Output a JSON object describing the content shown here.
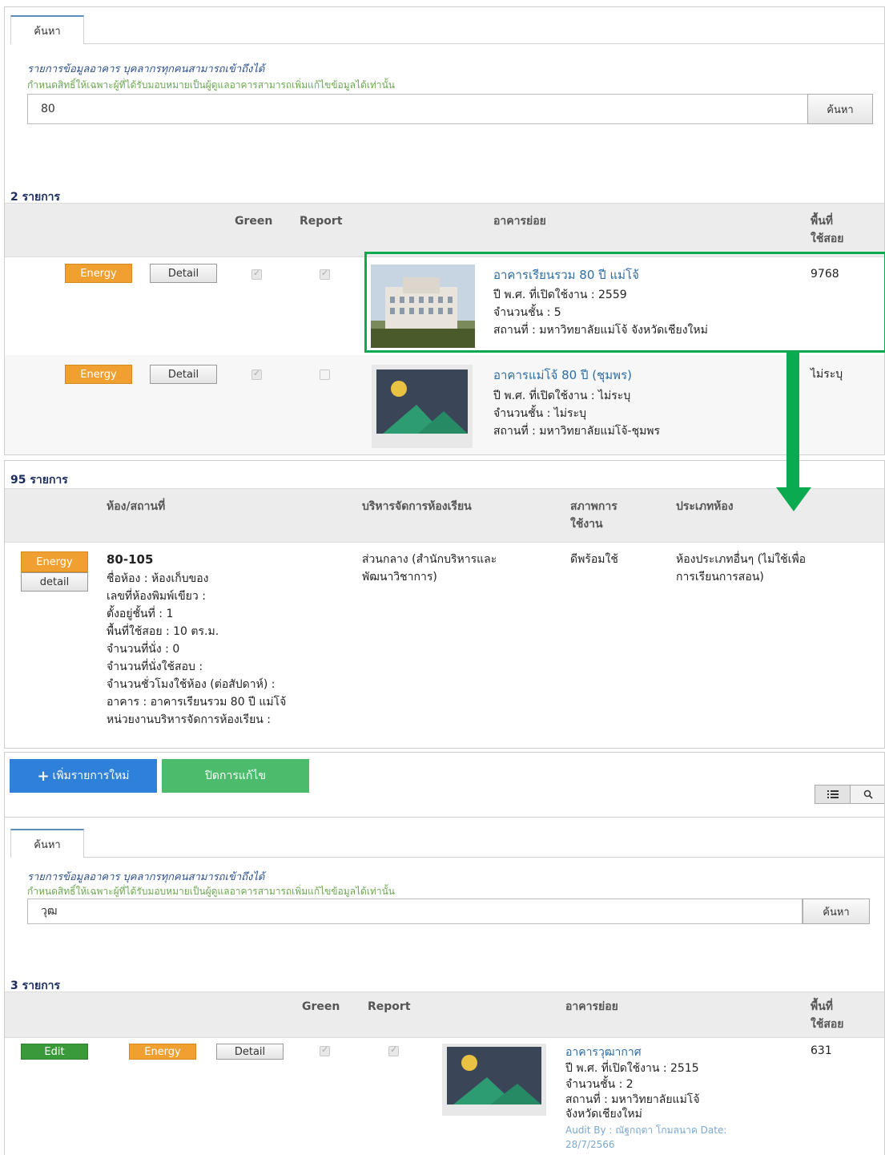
{
  "panel1": {
    "tab": "ค้นหา",
    "info_line1": "รายการข้อมูลอาคาร บุคลากรทุกคนสามารถเข้าถึงได้",
    "info_line2": "กำหนดสิทธิ์ให้เฉพาะผู้ที่ได้รับมอบหมายเป็นผู้ดูแลอาคารสามารถเพิ่มแก้ไขข้อมูลได้เท่านั้น",
    "search_value": "80",
    "search_btn": "ค้นหา",
    "count": "2 รายการ",
    "headers": {
      "green": "Green",
      "report": "Report",
      "sub": "อาคารย่อย",
      "area1": "พื้นที่",
      "area2": "ใช้สอย"
    },
    "rows": [
      {
        "energy": "Energy",
        "detail": "Detail",
        "green": true,
        "report": true,
        "name": "อาคารเรียนรวม 80 ปี แม่โจ้",
        "year": "ปี พ.ศ. ที่เปิดใช้งาน : 2559",
        "floors": "จำนวนชั้น : 5",
        "place": "สถานที่ : มหาวิทยาลัยแม่โจ้ จังหวัดเชียงใหม่",
        "area": "9768"
      },
      {
        "energy": "Energy",
        "detail": "Detail",
        "green": true,
        "report": false,
        "name": "อาคารแม่โจ้ 80 ปี (ชุมพร)",
        "year": "ปี พ.ศ. ที่เปิดใช้งาน : ไม่ระบุ",
        "floors": "จำนวนชั้น : ไม่ระบุ",
        "place": "สถานที่ : มหาวิทยาลัยแม่โจ้-ชุมพร",
        "area": "ไม่ระบุ"
      }
    ]
  },
  "panel2": {
    "count": "95 รายการ",
    "headers": {
      "room": "ห้อง/สถานที่",
      "manage": "บริหารจัดการห้องเรียน",
      "status1": "สภาพการ",
      "status2": "ใช้งาน",
      "type": "ประเภทห้อง"
    },
    "row": {
      "energy": "Energy",
      "detail": "detail",
      "code": "80-105",
      "lines": [
        "ชื่อห้อง : ห้องเก็บของ",
        "เลขที่ห้องพิมพ์เขียว :",
        "ตั้งอยู่ชั้นที่ : 1",
        "พื้นที่ใช้สอย : 10 ตร.ม.",
        "จำนวนที่นั่ง : 0",
        "จำนวนที่นั่งใช้สอบ :",
        "จำนวนชั่วโมงใช้ห้อง (ต่อสัปดาห์) :",
        "อาคาร : อาคารเรียนรวม 80 ปี แม่โจ้",
        "หน่วยงานบริหารจัดการห้องเรียน :"
      ],
      "manage1": "ส่วนกลาง (สำนักบริหารและ",
      "manage2": "พัฒนาวิชาการ)",
      "status": "ดีพร้อมใช้",
      "type1": "ห้องประเภทอื่นๆ (ไม่ใช้เพื่อ",
      "type2": "การเรียนการสอน)"
    }
  },
  "panel3": {
    "add_btn": "เพิ่มรายการใหม่",
    "close_btn": "ปิดการแก้ไข",
    "tab": "ค้นหา",
    "info_line1": "รายการข้อมูลอาคาร บุคลากรทุกคนสามารถเข้าถึงได้",
    "info_line2": "กำหนดสิทธิ์ให้เฉพาะผู้ที่ได้รับมอบหมายเป็นผู้ดูแลอาคารสามารถเพิ่มแก้ไขข้อมูลได้เท่านั้น",
    "search_value": "วุฒ",
    "search_btn": "ค้นหา",
    "count": "3 รายการ",
    "headers": {
      "green": "Green",
      "report": "Report",
      "sub": "อาคารย่อย",
      "area1": "พื้นที่",
      "area2": "ใช้สอย"
    },
    "row": {
      "edit": "Edit",
      "energy": "Energy",
      "detail": "Detail",
      "green": true,
      "report": true,
      "name": "อาคารวุฒากาศ",
      "year": "ปี พ.ศ. ที่เปิดใช้งาน : 2515",
      "floors": "จำนวนชั้น : 2",
      "place1": "สถานที่ : มหาวิทยาลัยแม่โจ้",
      "place2": "จังหวัดเชียงใหม่",
      "audit1": "Audit By : ณัฐกฤตา โกมลนาค Date:",
      "audit2": "28/7/2566",
      "area": "631"
    }
  },
  "colors": {
    "highlight": "#0aaa50",
    "orange": "#f0a030",
    "blue_btn": "#2f80d8",
    "green_btn": "#4cbb6c"
  }
}
